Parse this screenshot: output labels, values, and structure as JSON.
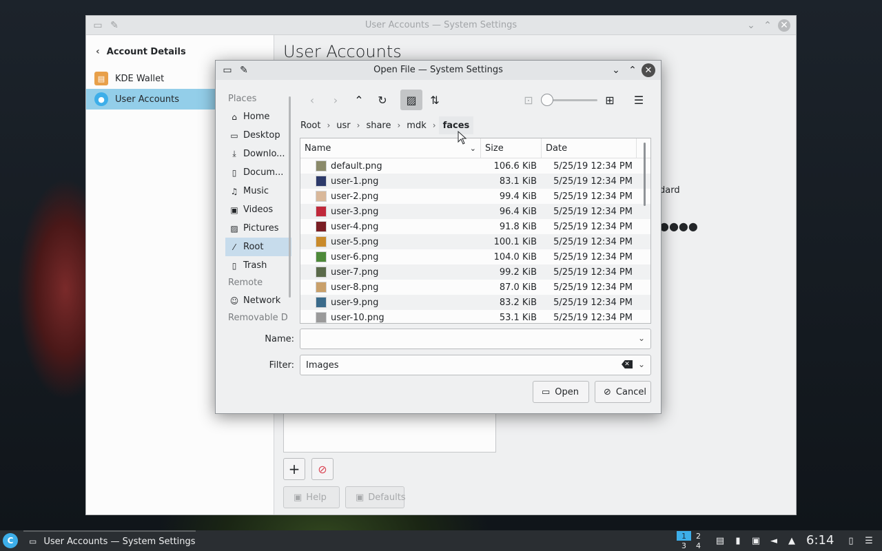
{
  "main_window": {
    "title": "User Accounts — System Settings",
    "sidebar_header": "Account Details",
    "sidebar_items": [
      {
        "label": "KDE Wallet",
        "icon": "wallet-icon"
      },
      {
        "label": "User Accounts",
        "icon": "user-icon"
      }
    ],
    "page_title": "User Accounts",
    "fragment_text": "dard",
    "fragment_dots": "●●●●",
    "help_label": "Help",
    "defaults_label": "Defaults"
  },
  "dialog": {
    "title": "Open File — System Settings",
    "places_header": "Places",
    "places": [
      {
        "label": "Home",
        "icon": "home-icon"
      },
      {
        "label": "Desktop",
        "icon": "desktop-icon"
      },
      {
        "label": "Downlo...",
        "icon": "download-icon"
      },
      {
        "label": "Docum...",
        "icon": "document-icon"
      },
      {
        "label": "Music",
        "icon": "music-icon"
      },
      {
        "label": "Videos",
        "icon": "video-icon"
      },
      {
        "label": "Pictures",
        "icon": "picture-icon"
      },
      {
        "label": "Root",
        "icon": "root-icon",
        "selected": true
      },
      {
        "label": "Trash",
        "icon": "trash-icon"
      }
    ],
    "remote_header": "Remote",
    "remote_places": [
      {
        "label": "Network",
        "icon": "network-icon"
      }
    ],
    "removable_header": "Removable D",
    "breadcrumb": [
      "Root",
      "usr",
      "share",
      "mdk",
      "faces"
    ],
    "columns": {
      "name": "Name",
      "size": "Size",
      "date": "Date"
    },
    "files": [
      {
        "name": "default.png",
        "size": "106.6 KiB",
        "date": "5/25/19 12:34 PM",
        "thumb": "#8a8a6a"
      },
      {
        "name": "user-1.png",
        "size": "83.1 KiB",
        "date": "5/25/19 12:34 PM",
        "thumb": "#2d3a6a"
      },
      {
        "name": "user-2.png",
        "size": "99.4 KiB",
        "date": "5/25/19 12:34 PM",
        "thumb": "#d9b89a"
      },
      {
        "name": "user-3.png",
        "size": "96.4 KiB",
        "date": "5/25/19 12:34 PM",
        "thumb": "#c0283a"
      },
      {
        "name": "user-4.png",
        "size": "91.8 KiB",
        "date": "5/25/19 12:34 PM",
        "thumb": "#7a1e24"
      },
      {
        "name": "user-5.png",
        "size": "100.1 KiB",
        "date": "5/25/19 12:34 PM",
        "thumb": "#c98a2a"
      },
      {
        "name": "user-6.png",
        "size": "104.0 KiB",
        "date": "5/25/19 12:34 PM",
        "thumb": "#4e8a3a"
      },
      {
        "name": "user-7.png",
        "size": "99.2 KiB",
        "date": "5/25/19 12:34 PM",
        "thumb": "#5a6a4a"
      },
      {
        "name": "user-8.png",
        "size": "87.0 KiB",
        "date": "5/25/19 12:34 PM",
        "thumb": "#c9a06a"
      },
      {
        "name": "user-9.png",
        "size": "83.2 KiB",
        "date": "5/25/19 12:34 PM",
        "thumb": "#3a6a8a"
      },
      {
        "name": "user-10.png",
        "size": "53.1 KiB",
        "date": "5/25/19 12:34 PM",
        "thumb": "#9a9a9a"
      }
    ],
    "name_label": "Name:",
    "name_value": "",
    "filter_label": "Filter:",
    "filter_value": "Images",
    "open_label": "Open",
    "cancel_label": "Cancel"
  },
  "taskbar": {
    "task_label": "User Accounts — System Settings",
    "pager": [
      "1",
      "2",
      "3",
      "4"
    ],
    "clock": "6:14"
  },
  "colors": {
    "accent": "#3daee9",
    "selection": "#93cee9",
    "panel": "#2a2e32"
  }
}
